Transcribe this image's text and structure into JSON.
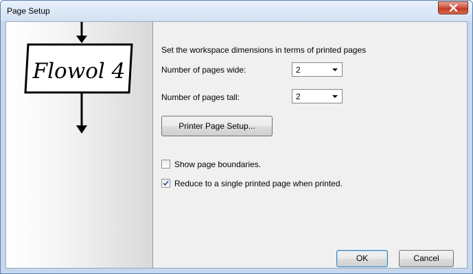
{
  "window": {
    "title": "Page Setup"
  },
  "logo": {
    "text": "Flowol 4"
  },
  "content": {
    "intro": "Set the workspace dimensions in terms of printed pages",
    "pages_wide": {
      "label": "Number of pages wide:",
      "value": "2"
    },
    "pages_tall": {
      "label": "Number of pages tall:",
      "value": "2"
    },
    "printer_button": "Printer Page Setup...",
    "show_boundaries": {
      "label": "Show page boundaries.",
      "checked": false
    },
    "reduce_single": {
      "label": "Reduce to a single printed page when printed.",
      "checked": true
    }
  },
  "buttons": {
    "ok": "OK",
    "cancel": "Cancel"
  },
  "icons": {
    "close": "close-icon",
    "check": "checkmark-icon",
    "dropdown": "chevron-down-icon",
    "arrow": "arrow-down-icon"
  },
  "colors": {
    "close_button": "#c03a22",
    "titlebar": "#d2e1f3"
  }
}
